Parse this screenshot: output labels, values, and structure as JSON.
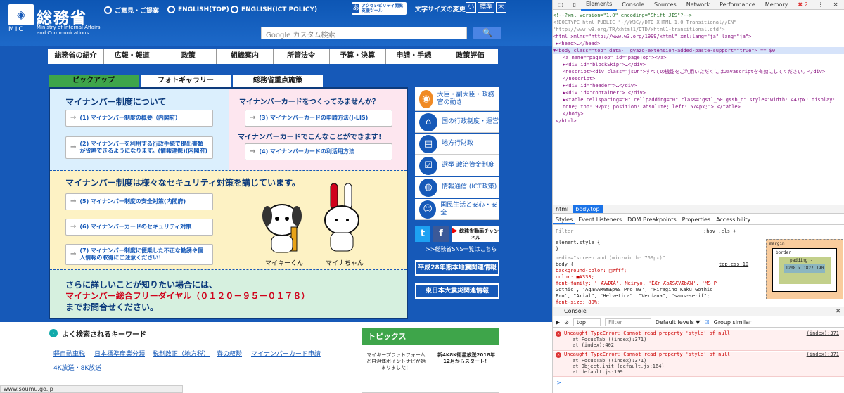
{
  "site": {
    "logo": {
      "kanji": "総務省",
      "mic": "MIC",
      "english": "Ministry of Internal Affairs and Communications"
    },
    "toplinks": [
      "ご意見・ご提案",
      "ENGLISH(TOP)",
      "ENGLISH(ICT POLICY)"
    ],
    "access_tool": "アクセシビリティ閲覧支援ツール",
    "fontsize": {
      "label": "文字サイズの変更",
      "small": "小",
      "standard": "標準",
      "large": "大"
    },
    "search": {
      "placeholder": "Google カスタム検索",
      "button": "🔍"
    },
    "nav": [
      "総務省の紹介",
      "広報・報道",
      "政策",
      "組織案内",
      "所管法令",
      "予算・決算",
      "申請・手続",
      "政策評価"
    ],
    "tabs": [
      "ピックアップ",
      "フォトギャラリー",
      "総務省重点施策"
    ],
    "panel": {
      "q1_title": "マイナンバー制度について",
      "q1_links": [
        "(1) マイナンバー制度の概要（内閣府）",
        "(2) マイナンバーを利用する行政手続で提出書類が省略できるようになります。(情報連携)(内閣府)"
      ],
      "q2_title1": "マイナンバーカードをつくってみませんか？",
      "q2_link1": "(3) マイナンバーカードの申請方法(J-LIS)",
      "q2_title2": "マイナンバーカードでこんなことができます！",
      "q2_link2": "(4) マイナンバーカードの利活用方法",
      "q3_title": "マイナンバー制度は様々なセキュリティ対策を講じています。",
      "q3_links": [
        "(5) マイナンバー制度の安全対策(内閣府)",
        "(6) マイナンバーカードのセキュリティ対策",
        "(7) マイナンバー制度に便乗した不正な勧誘や個人情報の取得にご注意ください！"
      ],
      "char1": "マイキーくん",
      "char2": "マイナちゃん",
      "q4_line1": "さらに詳しいことが知りたい場合には、",
      "q4_line2": "マイナンバー総合フリーダイヤル（０１２０－９５－０１７８）",
      "q4_line3": "までお問合せください。"
    },
    "side": [
      "大臣・副大臣・政務官の動き",
      "国の行政制度・運営",
      "地方行財政",
      "選挙 政治資金制度",
      "情報通信 (ICT政策)",
      "国民生活と安心・安全"
    ],
    "side_icons": [
      "camera-icon",
      "building-icon",
      "chair-icon",
      "ballot-icon",
      "globe-icon",
      "people-icon"
    ],
    "sns_link": ">>総務省SNS一覧はこちら",
    "youtube": "総務省動画チャンネル",
    "banner1": "平成28年熊本地震関連情報",
    "banner2": "東日本大震災関連情報",
    "keywords_title": "よく検索されるキーワード",
    "keywords": [
      "軽自動車税",
      "日本標準産業分類",
      "税制改正（地方税）",
      "春の叙勲",
      "マイナンバーカード申請",
      "4K放送・8K放送"
    ],
    "topics_title": "トピックス",
    "topic1": "マイキープラットフォームと自治体ポイントナビが始まりました！",
    "topic2": "新4K8K衛星放送2018年12月からスタート！",
    "status_url": "www.soumu.go.jp"
  },
  "devtools": {
    "tabs": [
      "Elements",
      "Console",
      "Sources",
      "Network",
      "Performance",
      "Memory"
    ],
    "error_count": "2",
    "dom": [
      "<!--?xml version=\"1.0\" encoding=\"Shift_JIS\"?-->",
      "<!DOCTYPE html PUBLIC \"-//W3C//DTD XHTML 1.0 Transitional//EN\"",
      "\"http://www.w3.org/TR/xhtml1/DTD/xhtml1-transitional.dtd\">",
      "<html xmlns=\"http://www.w3.org/1999/xhtml\" xml:lang=\"ja\" lang=\"ja\">",
      "▶<head>…</head>",
      "▼<body class=\"top\" data-__gyazo-extension-added-paste-support=\"true\"> == $0",
      "  <a name=\"pageTop\" id=\"pageTop\"></a>",
      "  ▶<div id=\"blockSkip\">…</div>",
      "  <noscript><div class=\"jsOn\">すべての機能をご利用いただくにはJavascriptを有効にしてください。</div>",
      "  </noscript>",
      "  ▶<div id=\"header\">…</div>",
      "  ▶<div id=\"container\">…</div>",
      "  ▶<table cellspacing=\"0\" cellpadding=\"0\" class=\"gstl_50 gssb_c\" style=\"width: 447px; display:",
      "  none; top: 92px; position: absolute; left: 574px;\">…</table>",
      "  </body>",
      "</html>"
    ],
    "crumbs": [
      "html",
      "body.top"
    ],
    "subtabs": [
      "Styles",
      "Event Listeners",
      "DOM Breakpoints",
      "Properties",
      "Accessibility"
    ],
    "filter": "Filter",
    "hov_cls": ":hov .cls +",
    "styles": [
      "element.style {",
      "}",
      "media=\"screen and (min-width: 769px)\"",
      "body {",
      "  background-color: □#fff;",
      "  color: ■#333;",
      "  font-family: 'ÆÁÆÆÁ', Meiryo, 'ÊÆr ÆoÆSÆVÆbÆN', 'MS P",
      "  Gothic', 'ÆqÆÆÆMÆmÆpÆS Pro W3', 'Hiragino Kaku Gothic",
      "  Pro', \"Arial\", \"Helvetica\", \"Verdana\", \"sans-serif\";",
      "  font-size: 80%;"
    ],
    "style_source": "top.css:10",
    "boxmodel": {
      "margin": "margin",
      "border": "border",
      "padding": "padding -",
      "content": "1208 × 1827.190"
    },
    "console_tab": "Console",
    "console_context": "top",
    "console_filter": "Filter",
    "levels": "Default levels ▼",
    "group_similar": "Group similar",
    "errors": [
      {
        "msg": "Uncaught TypeError: Cannot read property 'style' of null",
        "trace": [
          "at FocusTab ((index):371)",
          "at (index):402"
        ],
        "loc": "(index):371"
      },
      {
        "msg": "Uncaught TypeError: Cannot read property 'style' of null",
        "trace": [
          "at FocusTab ((index):371)",
          "at Object.init (default.js:164)",
          "at default.js:199"
        ],
        "loc": "(index):371"
      }
    ],
    "prompt": ">"
  }
}
